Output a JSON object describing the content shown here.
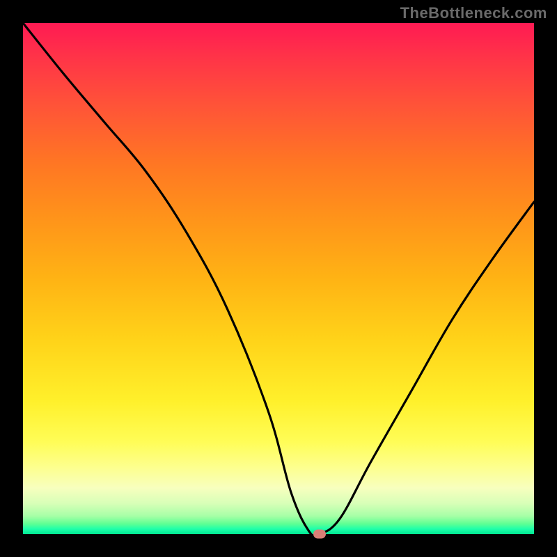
{
  "watermark": "TheBottleneck.com",
  "colors": {
    "frame": "#000000",
    "curve": "#000000",
    "marker": "#d97f76"
  },
  "chart_data": {
    "type": "line",
    "title": "",
    "xlabel": "",
    "ylabel": "",
    "xlim": [
      0,
      100
    ],
    "ylim": [
      0,
      100
    ],
    "ylim_inverted": false,
    "x": [
      0,
      8,
      16,
      24,
      32,
      40,
      48,
      52.5,
      56,
      58,
      62,
      68,
      76,
      84,
      92,
      100
    ],
    "values": [
      100,
      90,
      80.5,
      71,
      59,
      44,
      24,
      8,
      0.5,
      0,
      3,
      14,
      28,
      42,
      54,
      65
    ],
    "marker": {
      "x": 58,
      "y": 0
    },
    "grid": false,
    "legend": false
  }
}
